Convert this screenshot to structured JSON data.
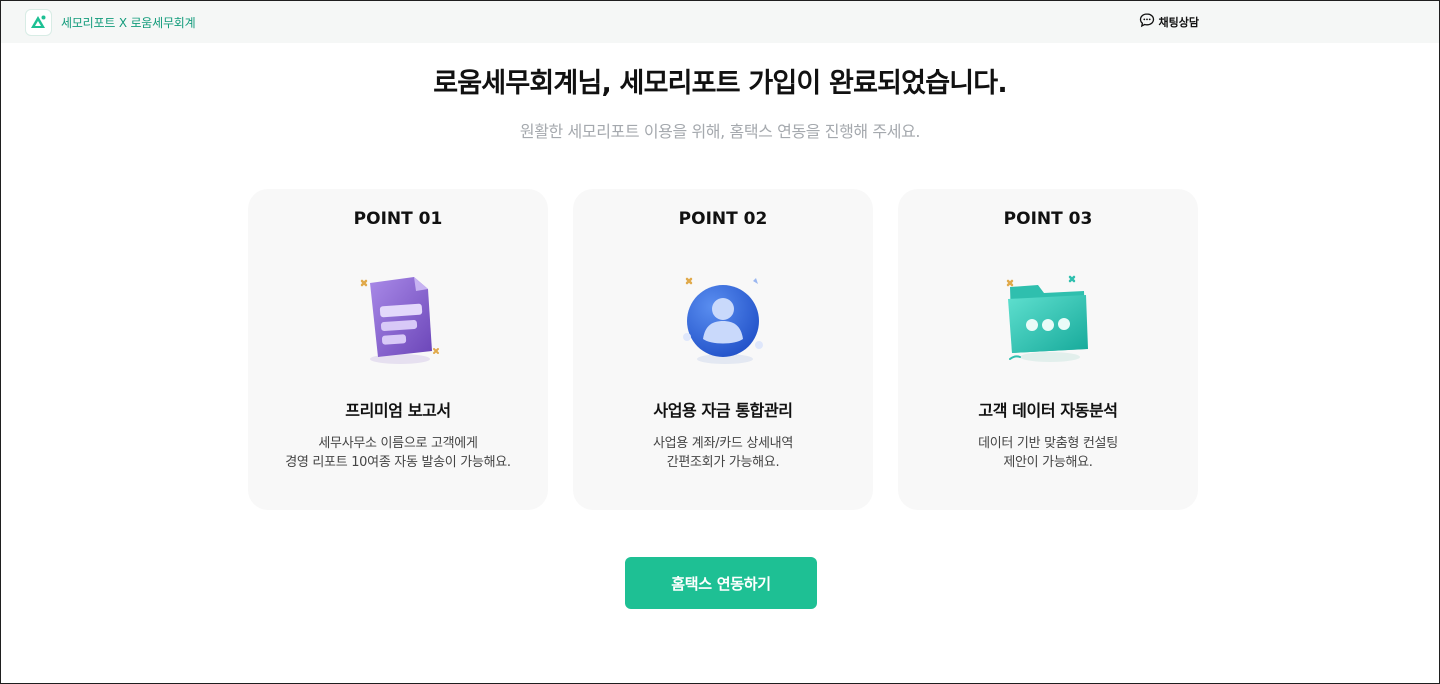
{
  "header": {
    "brand_name": "세모리포트 X 로움세무회계",
    "chat_label": "채팅상담"
  },
  "main": {
    "title": "로움세무회계님, 세모리포트 가입이 완료되었습니다.",
    "subtitle": "원활한 세모리포트 이용을 위해, 홈택스 연동을 진행해 주세요.",
    "cards": [
      {
        "point": "POINT 01",
        "icon": "document-icon",
        "title": "프리미엄 보고서",
        "desc": [
          "세무사무소 이름으로 고객에게",
          "경영 리포트 10여종 자동 발송이 가능해요."
        ]
      },
      {
        "point": "POINT 02",
        "icon": "user-badge-icon",
        "title": "사업용 자금 통합관리",
        "desc": [
          "사업용 계좌/카드 상세내역",
          "간편조회가 가능해요."
        ]
      },
      {
        "point": "POINT 03",
        "icon": "folder-icon",
        "title": "고객 데이터 자동분석",
        "desc": [
          "데이터 기반 맞춤형 컨설팅",
          "제안이 가능해요."
        ]
      }
    ],
    "cta_label": "홈택스 연동하기"
  },
  "colors": {
    "accent": "#1ec094",
    "brand_text": "#149c7c",
    "header_bg": "#f5f7f6",
    "card_bg": "#f8f8f8"
  }
}
